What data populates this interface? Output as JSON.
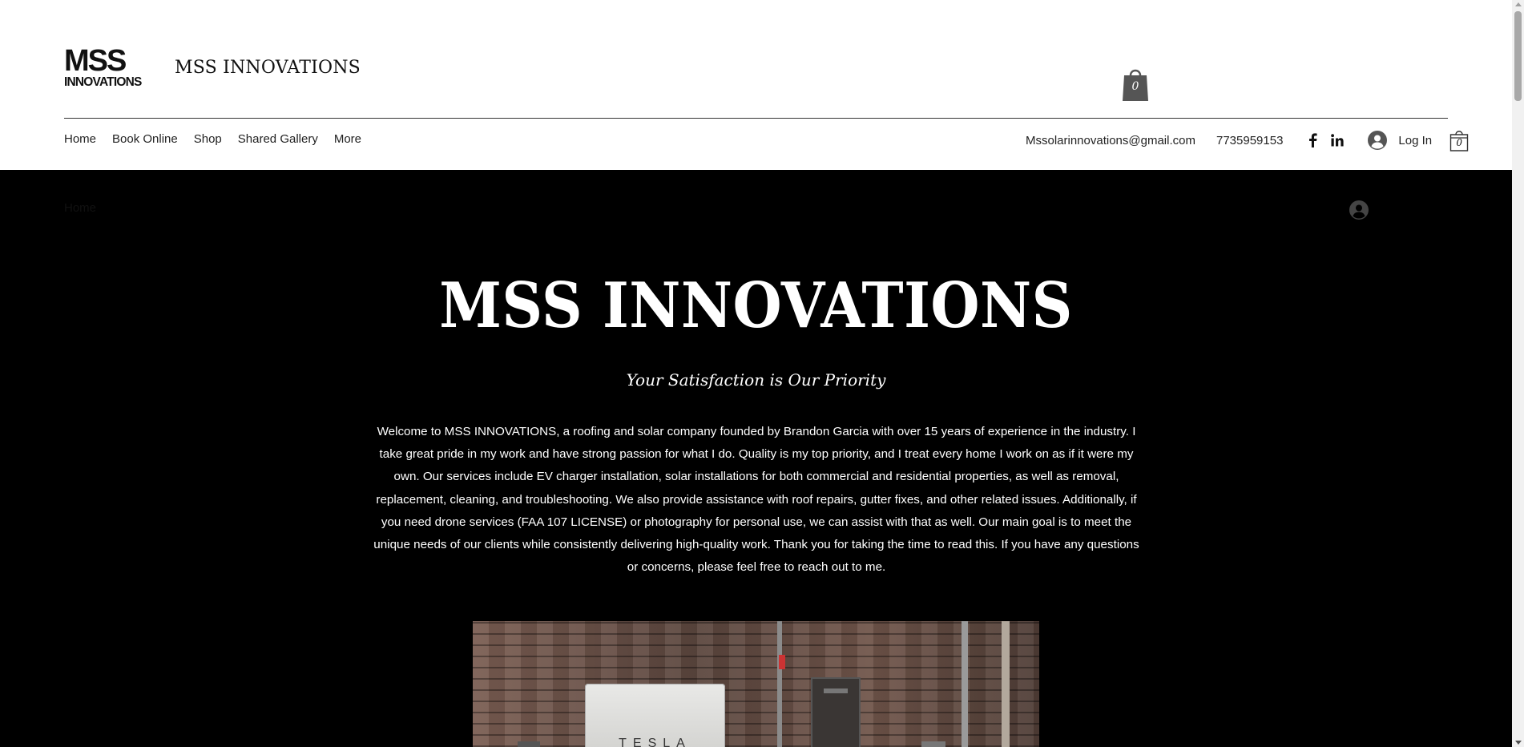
{
  "header": {
    "logo_text_top": "MSS",
    "logo_text_bottom": "INNOVATIONS",
    "site_name": "MSS INNOVATIONS",
    "cart_count": "0"
  },
  "nav": {
    "items": [
      {
        "label": "Home"
      },
      {
        "label": "Book Online"
      },
      {
        "label": "Shop"
      },
      {
        "label": "Shared Gallery"
      },
      {
        "label": "More"
      }
    ]
  },
  "contact": {
    "email": "Mssolarinnovations@gmail.com",
    "phone": "7735959153"
  },
  "social": {
    "icons": [
      "facebook-icon",
      "linkedin-icon"
    ]
  },
  "account": {
    "login_label": "Log In"
  },
  "hidden_bar": {
    "home_label": "Home"
  },
  "hero": {
    "title": "MSS INNOVATIONS",
    "tagline": "Your Satisfaction is Our Priority",
    "intro": "Welcome to MSS INNOVATIONS, a roofing and solar company founded by Brandon Garcia with over 15 years of experience in the industry. I take great pride in my work and have strong passion for what I do. Quality is my top priority, and I treat every home I work on as if it were my own. Our services include EV charger installation, solar installations for both commercial and residential properties, as well as removal, replacement, cleaning, and troubleshooting. We also provide assistance with roof repairs, gutter fixes, and other related issues. Additionally, if you need drone services (FAA 107 LICENSE) or photography for personal use, we can assist with that as well. Our main goal is to meet the unique needs of our clients while consistently delivering high-quality work. Thank you for taking the time to read this. If you have any questions or concerns, please feel free to reach out to me."
  },
  "photo": {
    "equipment_label": "TESLA"
  },
  "colors": {
    "header_bg": "#ffffff",
    "body_bg": "#000000",
    "text_dark": "#222222",
    "text_light": "#ffffff"
  }
}
